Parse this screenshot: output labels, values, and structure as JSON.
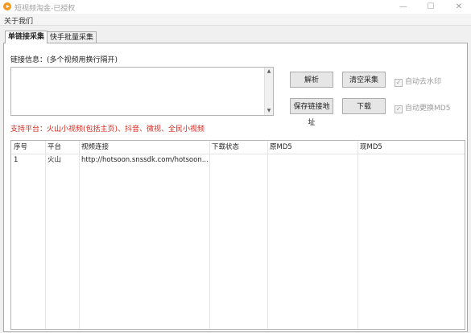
{
  "window": {
    "title": "短视频淘金-已授权",
    "minimize_glyph": "—",
    "maximize_glyph": "☐",
    "close_glyph": "✕"
  },
  "menu": {
    "about": "关于我们"
  },
  "tabs": [
    {
      "label": "单链接采集",
      "active": true
    },
    {
      "label": "快手批量采集",
      "active": false
    }
  ],
  "link_section": {
    "label": "链接信息：(多个视频用换行隔开)",
    "value": ""
  },
  "buttons": {
    "parse": "解析",
    "clear": "清空采集",
    "save_links": "保存链接地址",
    "download": "下载"
  },
  "checkboxes": {
    "auto_watermark": {
      "label": "自动去水印",
      "checked": true
    },
    "auto_md5": {
      "label": "自动更换MD5",
      "checked": true
    }
  },
  "platforms_text": "支持平台：火山小视频(包括主页)、抖音、微视、全民小视频",
  "table": {
    "columns": [
      "序号",
      "平台",
      "视频连接",
      "下载状态",
      "原MD5",
      "现MD5"
    ],
    "rows": [
      [
        "1",
        "火山",
        "http://hotsoon.snssdk.com/hotsoon...",
        "",
        "",
        ""
      ]
    ]
  },
  "colors": {
    "platform_text": "#d9261c",
    "app_icon": "#f39a1c"
  },
  "icons": [
    "app-logo-icon",
    "scroll-up-arrow-icon",
    "scroll-down-arrow-icon",
    "checkmark-icon"
  ]
}
